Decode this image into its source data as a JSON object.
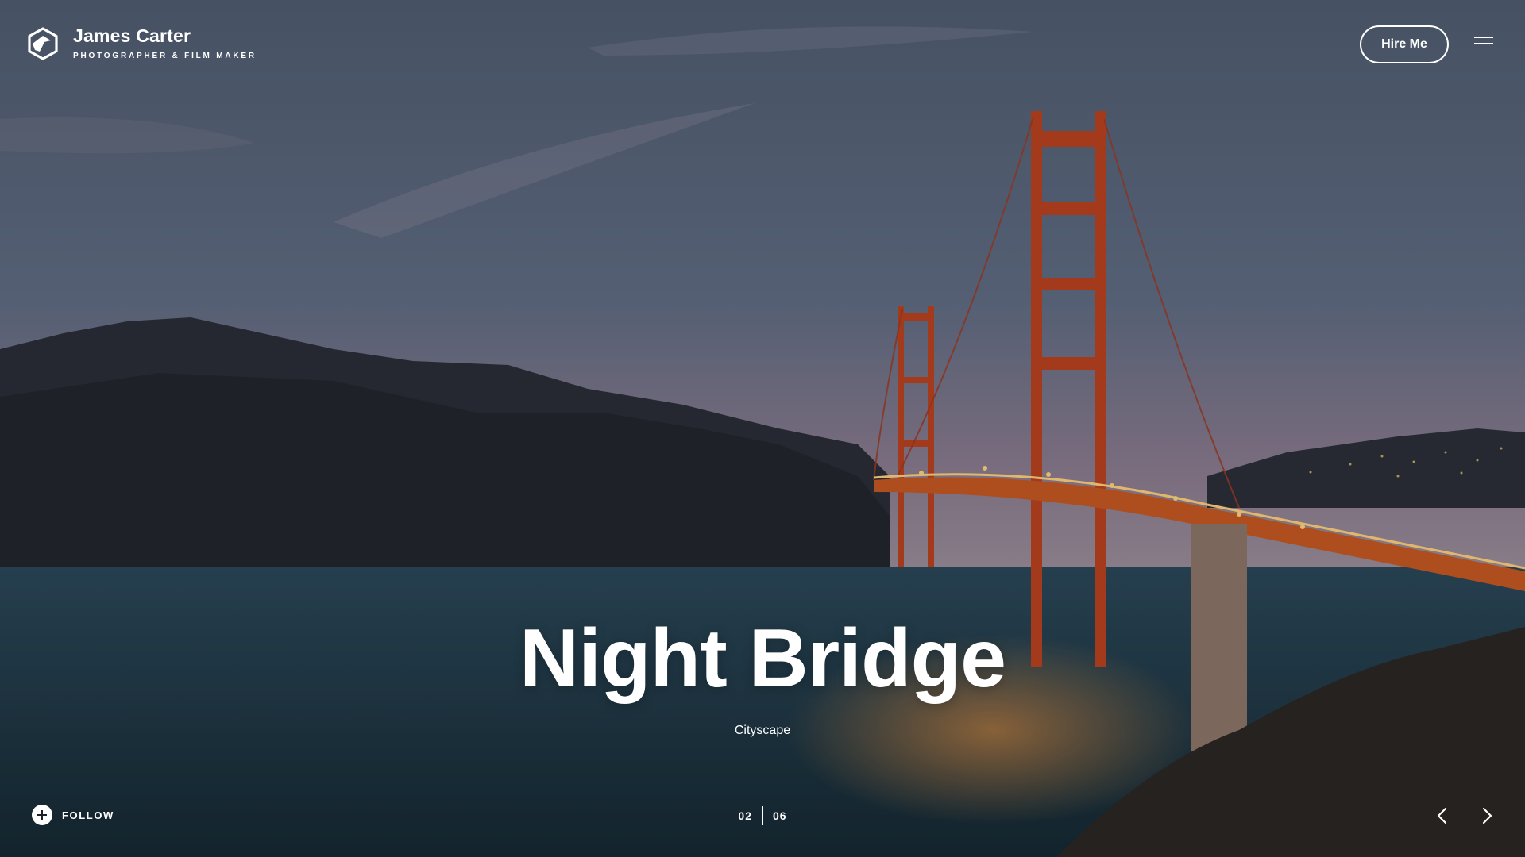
{
  "brand": {
    "name": "James Carter",
    "tagline": "PHOTOGRAPHER & FILM MAKER"
  },
  "header": {
    "hire_label": "Hire Me",
    "menu_icon": "hamburger-icon"
  },
  "slide": {
    "title": "Night Bridge",
    "category": "Cityscape",
    "current": "02",
    "total": "06"
  },
  "footer": {
    "follow_label": "FOLLOW",
    "follow_icon": "plus-circle-icon",
    "prev_icon": "chevron-left-icon",
    "next_icon": "chevron-right-icon"
  },
  "colors": {
    "bridge": "#c4461f",
    "sky": "#5e6a80",
    "water": "#1f3a48",
    "lights": "#ffb347"
  }
}
